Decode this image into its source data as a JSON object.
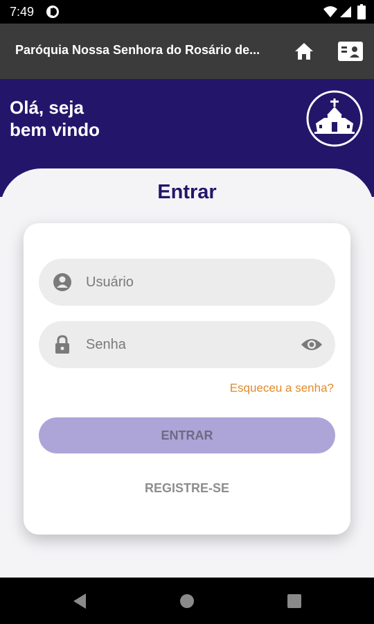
{
  "status_bar": {
    "time": "7:49"
  },
  "app_bar": {
    "title": "Paróquia Nossa Senhora do Rosário de..."
  },
  "hero": {
    "greeting_line1": "Olá, seja",
    "greeting_line2": "bem vindo"
  },
  "login": {
    "heading": "Entrar",
    "username_placeholder": "Usuário",
    "password_placeholder": "Senha",
    "forgot_label": "Esqueceu a senha?",
    "enter_label": "ENTRAR",
    "register_label": "REGISTRE-SE"
  },
  "colors": {
    "primary": "#23166a",
    "app_bar": "#3b3b3b",
    "button_disabled": "#ada5d7",
    "link": "#e08a2a"
  }
}
